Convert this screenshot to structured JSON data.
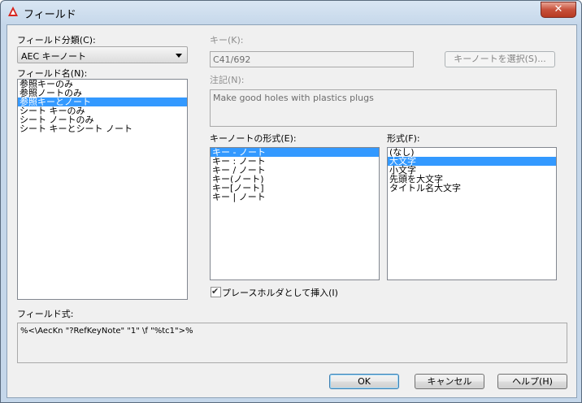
{
  "window": {
    "title": "フィールド",
    "close_glyph": "✕"
  },
  "left": {
    "category_label": "フィールド分類(C):",
    "category_value": "AEC キーノート",
    "fieldname_label": "フィールド名(N):",
    "fieldnames": [
      "参照キーのみ",
      "参照ノートのみ",
      "参照キーとノート",
      "シート キーのみ",
      "シート ノートのみ",
      "シート キーとシート ノート"
    ],
    "fieldname_selected": 2
  },
  "key": {
    "label": "キー(K):",
    "value": "C41/692",
    "select_button": "キーノートを選択(S)..."
  },
  "note": {
    "label": "注記(N):",
    "value": "Make good holes with plastics plugs"
  },
  "keynote_format": {
    "label": "キーノートの形式(E):",
    "items": [
      "キー - ノート",
      "キー : ノート",
      "キー / ノート",
      "キー(ノート)",
      "キー[ノート]",
      "キー | ノート"
    ],
    "selected": 0
  },
  "format": {
    "label": "形式(F):",
    "items": [
      "(なし)",
      "大文字",
      "小文字",
      "先頭を大文字",
      "タイトル名大文字"
    ],
    "selected": 1
  },
  "placeholder_checkbox": {
    "label": "プレースホルダとして挿入(I)",
    "checked": true
  },
  "expression": {
    "label": "フィールド式:",
    "value": "%<\\AecKn \"?RefKeyNote\" \"1\" \\f \"%tc1\">%"
  },
  "buttons": {
    "ok": "OK",
    "cancel": "キャンセル",
    "help": "ヘルプ(H)"
  },
  "colors": {
    "selection": "#3399ff",
    "dialog_bg": "#f0f0f0",
    "title_bar": "#c5d7ea",
    "close_button": "#c7503a"
  }
}
